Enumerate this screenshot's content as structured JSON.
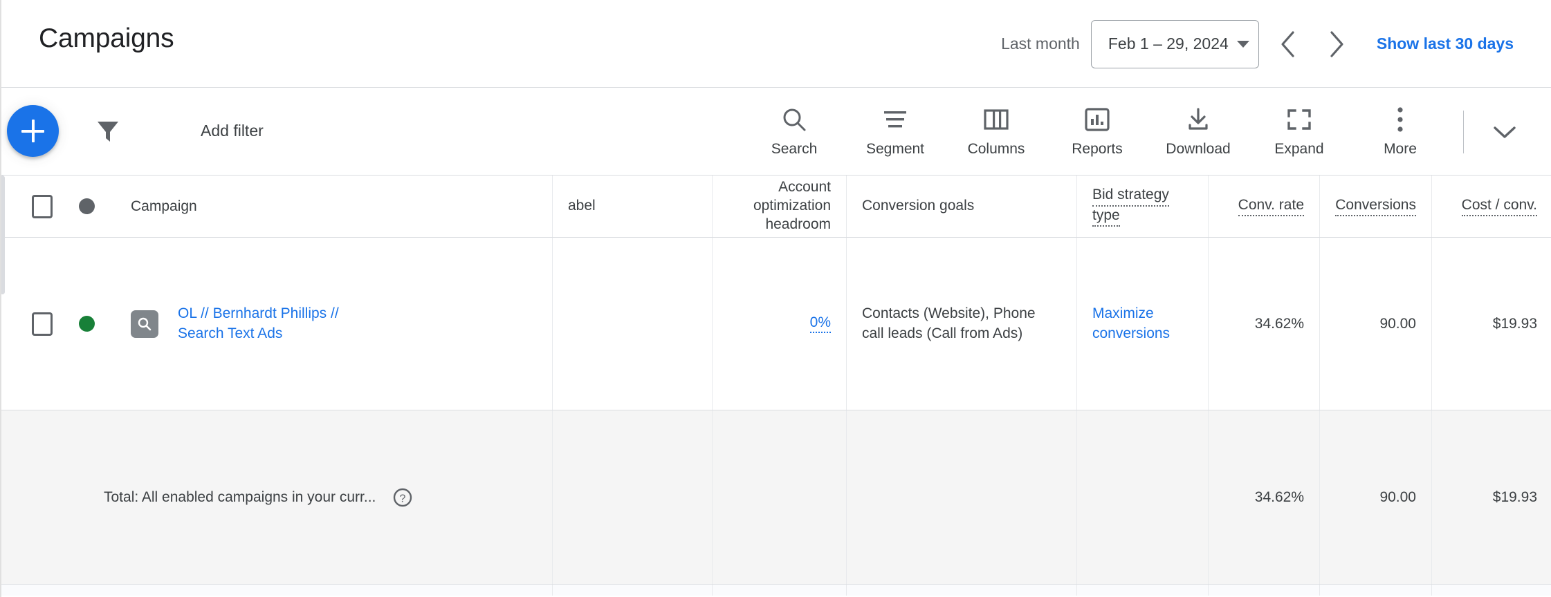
{
  "header": {
    "title": "Campaigns",
    "date_preset_label": "Last month",
    "date_range": "Feb 1 – 29, 2024",
    "prev_icon": "chevron-left-icon",
    "next_icon": "chevron-right-icon",
    "show_last_30_days": "Show last 30 days"
  },
  "toolbar": {
    "create_icon": "plus-icon",
    "filter_icon": "funnel-icon",
    "add_filter_label": "Add filter",
    "actions": [
      {
        "label": "Search",
        "icon": "search-icon"
      },
      {
        "label": "Segment",
        "icon": "segment-icon"
      },
      {
        "label": "Columns",
        "icon": "columns-icon"
      },
      {
        "label": "Reports",
        "icon": "reports-chart-icon"
      },
      {
        "label": "Download",
        "icon": "download-icon"
      },
      {
        "label": "Expand",
        "icon": "expand-icon"
      },
      {
        "label": "More",
        "icon": "more-vertical-icon"
      }
    ],
    "collapse_icon": "chevron-down-icon"
  },
  "table": {
    "headers": {
      "campaign": "Campaign",
      "label": "abel",
      "headroom_line1": "Account",
      "headroom_line2": "optimization",
      "headroom_line3": "headroom",
      "conversion_goals": "Conversion goals",
      "bid_strategy_line1": "Bid strategy",
      "bid_strategy_line2": "type",
      "conv_rate": "Conv. rate",
      "conversions": "Conversions",
      "cost_conv": "Cost / conv."
    },
    "rows": [
      {
        "status": "enabled",
        "status_color": "#188038",
        "type_icon": "search-campaign-icon",
        "campaign_line1": "OL // Bernhardt Phillips //",
        "campaign_line2": "Search Text Ads",
        "label": "",
        "headroom": "0%",
        "goals_line1": "Contacts (Website), Phone",
        "goals_line2": "call leads (Call from Ads)",
        "bid_strategy_line1": "Maximize",
        "bid_strategy_line2": "conversions",
        "conv_rate": "34.62%",
        "conversions": "90.00",
        "cost_conv": "$19.93"
      }
    ],
    "total": {
      "label": "Total: All enabled campaigns in your curr...",
      "help_icon": "help-circle-icon",
      "conv_rate": "34.62%",
      "conversions": "90.00",
      "cost_conv": "$19.93"
    }
  },
  "colors": {
    "accent_blue": "#1a73e8",
    "status_enabled_green": "#188038",
    "text_primary": "#3c4043",
    "text_secondary": "#5f6368",
    "border": "#dadce0",
    "total_row_bg": "#f5f5f5"
  }
}
